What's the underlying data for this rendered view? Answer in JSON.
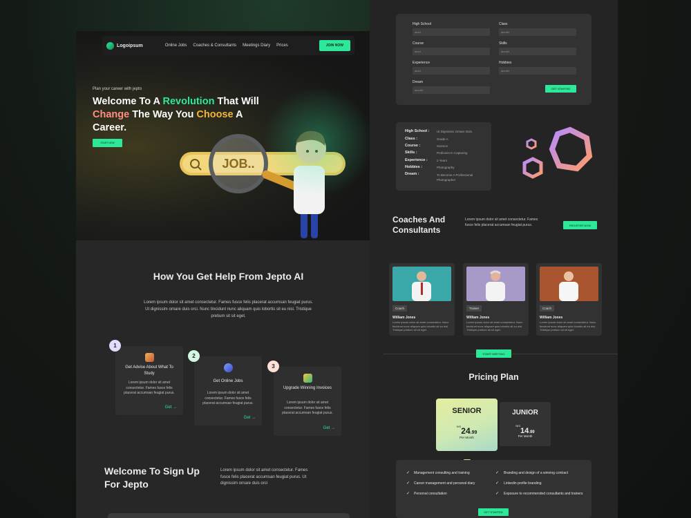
{
  "brand": {
    "logo_text": "Logoipsum",
    "accent": "#2ee89a"
  },
  "nav": {
    "links": [
      "Online Jobs",
      "Coaches & Consultants",
      "Meetings Diary",
      "Prices"
    ],
    "join_label": "JOIN NOW"
  },
  "hero": {
    "eyebrow": "Plan your career with jepto",
    "title_parts": [
      "Welcome To A ",
      "Revolution",
      " That Will ",
      "Change",
      " The Way You ",
      "Choose",
      " A Career."
    ],
    "start_label": "START NOW",
    "search_text": "JOB.."
  },
  "help": {
    "title": "How You Get Help From Jepto AI",
    "description": "Lorem ipsum dolor sit amet consectetur. Fames fusce felis placerat accumsan feugiat purus. Ut dignissim ornare duis orci. Nunc tincidunt nunc aliquam quis lobortis sit eu nisl. Tristique pretium sit sit eget.",
    "steps": [
      {
        "num": "1",
        "title": "Get Advise About What To Study",
        "text": "Lorem ipsum dolor sit amet consectetur. Fames fusce felis placerat accumsan feugiat purus.",
        "get_label": "Get →"
      },
      {
        "num": "2",
        "title": "Get Online Jobs",
        "text": "Lorem ipsum dolor sit amet consectetur. Fames fusce felis placerat accumsan feugiat purus.",
        "get_label": "Get →"
      },
      {
        "num": "3",
        "title": "Upgrade Winning Invoices",
        "text": "Lorem ipsum dolor sit amet consectetur. Fames fusce felis placerat accumsan feugiat purus.",
        "get_label": "Get →"
      }
    ]
  },
  "signup": {
    "title": "Welcome To Sign Up For Jepto",
    "description": "Lorem ipsum dolor sit amet consectetur. Fames fusce felis placerat accumsan feugiat purus. Ut dignissim ornare duis orci"
  },
  "form": {
    "fields": [
      {
        "label": "High School",
        "value": "abcd"
      },
      {
        "label": "Class",
        "value": "abcdef"
      },
      {
        "label": "Course",
        "value": "abcd"
      },
      {
        "label": "Skills",
        "value": "abcdef"
      },
      {
        "label": "Experience",
        "value": "abcd"
      },
      {
        "label": "Hobbies",
        "value": "abcdef"
      },
      {
        "label": "Dream",
        "value": "abcdef"
      }
    ],
    "submit_label": "GET STARTED"
  },
  "profile": {
    "rows": [
      {
        "label": "High School :",
        "value": "Ut Dignissim Ornare Duis."
      },
      {
        "label": "Class :",
        "value": "Grade A"
      },
      {
        "label": "Course :",
        "value": "Science"
      },
      {
        "label": "Skills :",
        "value": "Proficient In Capturing"
      },
      {
        "label": "Experience :",
        "value": "2 Years"
      },
      {
        "label": "Hobbies :",
        "value": "Photography"
      },
      {
        "label": "Dream :",
        "value": "To Become A Professional Photographer"
      }
    ]
  },
  "coaches": {
    "title": "Coaches And Consultants",
    "description": "Lorem ipsum dolor sit amet consectetur. Fames fusce felis placerat accumsan feugiat purus.",
    "register_label": "REGISTER NOW",
    "cards": [
      {
        "role": "Coach",
        "name": "William Jones",
        "text": "Lorem ipsum dolor sit amet consectetur. Nunc tincidunt nunc aliquam quis lobortis sit eu nisl. Tristique pretium sit sit eget.",
        "bg": "#3aa8a8"
      },
      {
        "role": "Trainer",
        "name": "William Jones",
        "text": "Lorem ipsum dolor sit amet consectetur. Nunc tincidunt nunc aliquam quis lobortis sit eu nisl. Tristique pretium sit sit eget.",
        "bg": "#a79ac9"
      },
      {
        "role": "Coach",
        "name": "William Jones",
        "text": "Lorem ipsum dolor sit amet consectetur. Nunc tincidunt nunc aliquam quis lobortis sit eu nisl. Tristique pretium sit sit eget.",
        "bg": "#a85530"
      }
    ],
    "meeting_label": "START MEETING"
  },
  "pricing": {
    "title": "Pricing Plan",
    "senior": {
      "name": "SENIOR",
      "currency": "NIS",
      "whole": "24",
      "cents": ".99",
      "period": "Per Month"
    },
    "junior": {
      "name": "JUNIOR",
      "currency": "NIS",
      "whole": "14",
      "cents": ".99",
      "period": "Per Month"
    },
    "features": [
      "Management consulting and training",
      "Branding and design of a winning contract",
      "Career management and personal diary",
      "Linkedin profile branding",
      "Personal consultation",
      "Exposure to recommended consultants and trainers"
    ],
    "cta_label": "GET STARTED"
  }
}
